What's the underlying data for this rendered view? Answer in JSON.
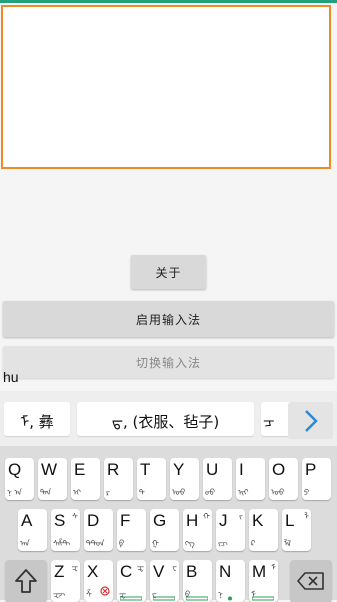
{
  "colors": {
    "accent": "#ee8a28",
    "status": "#22a07a",
    "link": "#2b8ad8"
  },
  "buttons": {
    "about": "关于",
    "enable": "启用输入法",
    "switch": "切换输入法"
  },
  "composing_text": "hu",
  "candidates": [
    "ᠮ, 彝",
    "ᠳ, (衣服、毡子)",
    "ᠴ"
  ],
  "next_icon": "chevron-right-icon",
  "keyboard": {
    "row1": [
      {
        "main": "Q",
        "side": "",
        "sub": "ᠨ ᠠ"
      },
      {
        "main": "W",
        "side": "",
        "sub": "ᠳᠠᠠ"
      },
      {
        "main": "E",
        "side": "",
        "sub": "ᠢ"
      },
      {
        "main": "R",
        "side": "",
        "sub": "ᠷ"
      },
      {
        "main": "T",
        "side": "",
        "sub": "ᠲ"
      },
      {
        "main": "Y",
        "side": "",
        "sub": "ᠣᠣ"
      },
      {
        "main": "U",
        "side": "",
        "sub": "ᠤᠤ"
      },
      {
        "main": "I",
        "side": "",
        "sub": "ᠢᠢ"
      },
      {
        "main": "O",
        "side": "",
        "sub": "ᠤᠣ"
      },
      {
        "main": "P",
        "side": "",
        "sub": "ᠫ"
      }
    ],
    "row2": [
      {
        "main": "A",
        "side": "",
        "sub": "ᠠᠡ"
      },
      {
        "main": "S",
        "side": "ᠰ",
        "sub": "ᠰᠱᠲ"
      },
      {
        "main": "D",
        "side": "",
        "sub": "ᠳᠲᠳ"
      },
      {
        "main": "F",
        "side": "",
        "sub": "ᠹ"
      },
      {
        "main": "G",
        "side": "",
        "sub": "ᠭ"
      },
      {
        "main": "H",
        "side": "ᠬ",
        "sub": "ᠬᠭ"
      },
      {
        "main": "J",
        "side": "ᠵ",
        "sub": "ᠵᠴ"
      },
      {
        "main": "K",
        "side": "",
        "sub": "ᠺ"
      },
      {
        "main": "L",
        "side": "ᠯ",
        "sub": "ᠯᠯ"
      }
    ],
    "row3": [
      {
        "main": "Z",
        "side": "ᠽ",
        "sub": "ᠽᠵ"
      },
      {
        "main": "X",
        "side": "",
        "sub": "ᠱ"
      },
      {
        "main": "C",
        "side": "ᠼ",
        "sub": "ᠼ"
      },
      {
        "main": "V",
        "side": "ᠸ",
        "sub": "ᠸ"
      },
      {
        "main": "B",
        "side": "",
        "sub": "ᠪ"
      },
      {
        "main": "N",
        "side": "",
        "sub": "ᠨ"
      },
      {
        "main": "M",
        "side": "ᠮ",
        "sub": "ᠮ"
      }
    ],
    "shift_icon": "shift-arrow-icon",
    "backspace_icon": "backspace-icon"
  }
}
